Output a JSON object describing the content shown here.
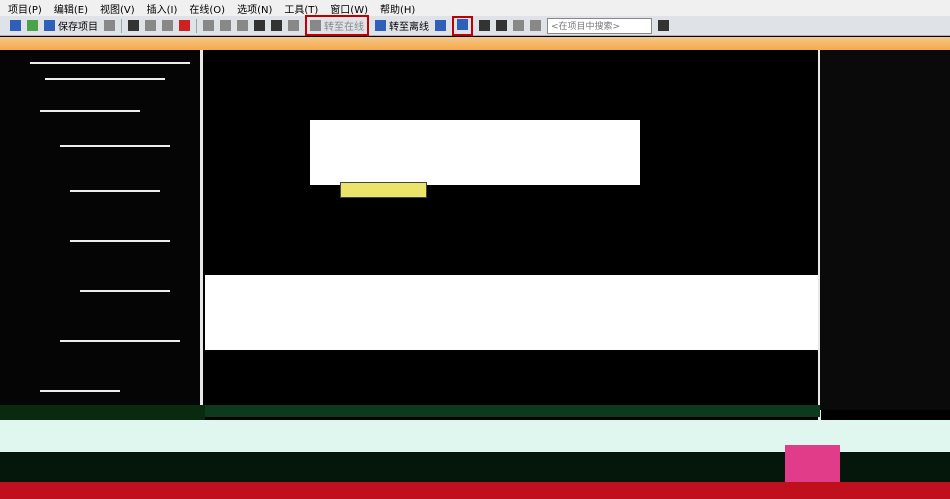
{
  "menubar": {
    "items": [
      "项目(P)",
      "编辑(E)",
      "视图(V)",
      "插入(I)",
      "在线(O)",
      "选项(N)",
      "工具(T)",
      "窗口(W)",
      "帮助(H)"
    ]
  },
  "toolbar": {
    "save_project": "保存项目",
    "go_online": "转至在线",
    "go_offline": "转至离线",
    "search_placeholder": "<在项目中搜索>"
  },
  "colors": {
    "highlight_box": "#c00000",
    "toolbar_bg": "#dfe3e8",
    "status_bar": "#c0101e"
  }
}
